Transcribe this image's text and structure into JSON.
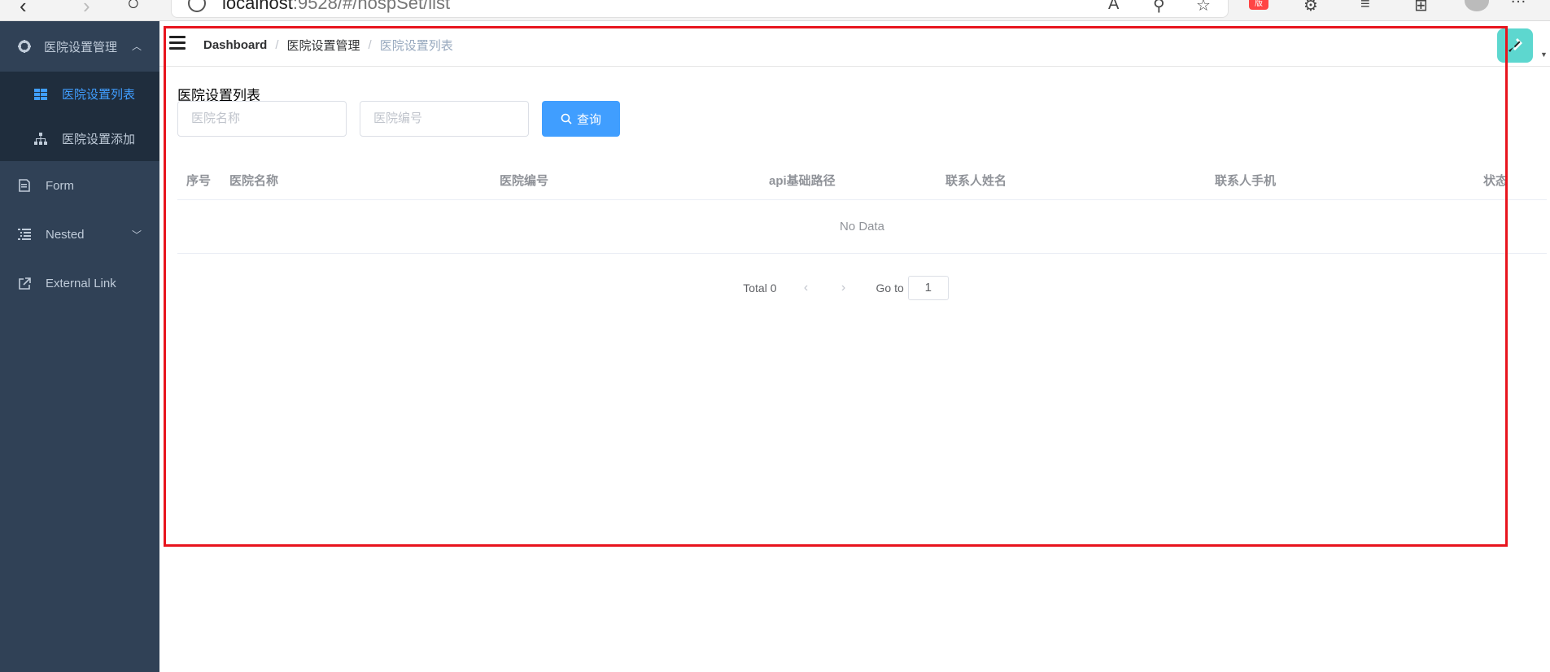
{
  "browser": {
    "url_host": "localhost",
    "url_rest": ":9528/#/hospSet/list",
    "ext_badge": "版"
  },
  "sidebar": {
    "group": {
      "label": "医院设置管理",
      "icon": "gear-icon"
    },
    "sub_items": [
      {
        "label": "医院设置列表",
        "icon": "table-icon",
        "active": true
      },
      {
        "label": "医院设置添加",
        "icon": "tree-icon",
        "active": false
      }
    ],
    "items": [
      {
        "label": "Form",
        "icon": "form-icon"
      },
      {
        "label": "Nested",
        "icon": "nested-icon"
      },
      {
        "label": "External Link",
        "icon": "link-icon"
      }
    ]
  },
  "breadcrumb": [
    "Dashboard",
    "医院设置管理",
    "医院设置列表"
  ],
  "breadcrumb_separator": "/",
  "page": {
    "title": "医院设置列表",
    "search": {
      "name_placeholder": "医院名称",
      "code_placeholder": "医院编号",
      "query_label": "查询"
    }
  },
  "table": {
    "columns": [
      "序号",
      "医院名称",
      "医院编号",
      "api基础路径",
      "联系人姓名",
      "联系人手机",
      "状态"
    ],
    "empty_text": "No Data"
  },
  "pagination": {
    "total_label": "Total 0",
    "goto_label": "Go to",
    "page": "1"
  },
  "colors": {
    "sidebar_bg": "#304156",
    "submenu_bg": "#1f2d3d",
    "primary": "#409eff",
    "highlight": "#e8141d"
  }
}
